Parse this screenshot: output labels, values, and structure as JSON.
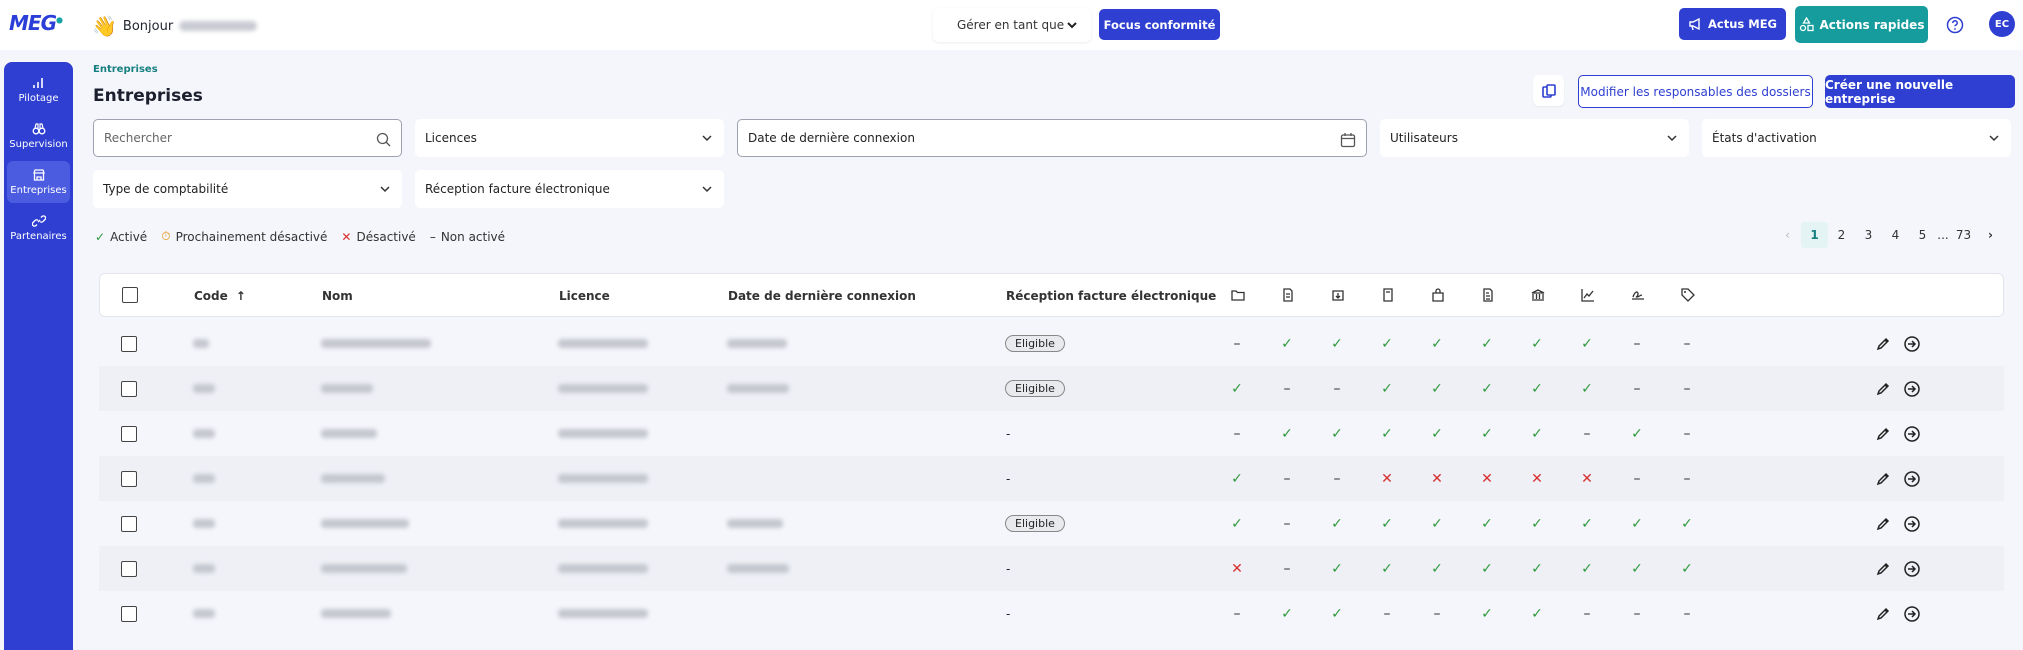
{
  "app": {
    "logo": "MEG",
    "greeting": "Bonjour",
    "user_initials": "EC"
  },
  "topbar": {
    "manage_as": "Gérer en tant que",
    "focus": "Focus conformité",
    "actus": "Actus MEG",
    "actions_rapides": "Actions rapides"
  },
  "sidebar": {
    "items": [
      {
        "label": "Pilotage",
        "icon": "bar-chart-icon"
      },
      {
        "label": "Supervision",
        "icon": "binoculars-icon"
      },
      {
        "label": "Entreprises",
        "icon": "store-icon",
        "active": true
      },
      {
        "label": "Partenaires",
        "icon": "link-icon"
      }
    ]
  },
  "page": {
    "breadcrumb": "Entreprises",
    "title": "Entreprises",
    "modify_btn": "Modifier les responsables des dossiers",
    "create_btn": "Créer une nouvelle entreprise"
  },
  "filters": {
    "search_placeholder": "Rechercher",
    "licences": "Licences",
    "date": "Date de dernière connexion",
    "users": "Utilisateurs",
    "activation": "États d'activation",
    "compta": "Type de comptabilité",
    "reception": "Réception facture électronique"
  },
  "legend": {
    "active": "Activé",
    "soon": "Prochainement désactivé",
    "disabled": "Désactivé",
    "inactive": "Non activé"
  },
  "pagination": {
    "pages": [
      "1",
      "2",
      "3",
      "4",
      "5"
    ],
    "ellipsis": "...",
    "last": "73",
    "current": "1"
  },
  "table": {
    "headers": {
      "code": "Code",
      "nom": "Nom",
      "licence": "Licence",
      "date": "Date de dernière connexion",
      "reception": "Réception facture électronique"
    },
    "module_icons": [
      "folder-icon",
      "document-icon",
      "import-icon",
      "calculator-icon",
      "bag-icon",
      "invoice-icon",
      "bank-icon",
      "chart-line-icon",
      "signature-icon",
      "tag-icon"
    ],
    "rows": [
      {
        "date": true,
        "reception": "Eligible",
        "modules": [
          "-",
          "v",
          "v",
          "v",
          "v",
          "v",
          "v",
          "v",
          "-",
          "-"
        ]
      },
      {
        "date": true,
        "reception": "Eligible",
        "modules": [
          "v",
          "-",
          "-",
          "v",
          "v",
          "v",
          "v",
          "v",
          "-",
          "-"
        ]
      },
      {
        "date": false,
        "reception": "-",
        "modules": [
          "-",
          "v",
          "v",
          "v",
          "v",
          "v",
          "v",
          "-",
          "v",
          "-"
        ]
      },
      {
        "date": false,
        "reception": "-",
        "modules": [
          "v",
          "-",
          "-",
          "x",
          "x",
          "x",
          "x",
          "x",
          "-",
          "-"
        ]
      },
      {
        "date": true,
        "reception": "Eligible",
        "modules": [
          "v",
          "-",
          "v",
          "v",
          "v",
          "v",
          "v",
          "v",
          "v",
          "v"
        ]
      },
      {
        "date": true,
        "reception": "-",
        "modules": [
          "x",
          "-",
          "v",
          "v",
          "v",
          "v",
          "v",
          "v",
          "v",
          "v"
        ]
      },
      {
        "date": false,
        "reception": "-",
        "modules": [
          "-",
          "v",
          "v",
          "-",
          "-",
          "v",
          "v",
          "-",
          "-",
          "-"
        ]
      }
    ]
  },
  "colors": {
    "primary": "#2e3fd1",
    "teal": "#169c9c",
    "ok": "#2e9a3d",
    "ko": "#d82e2e"
  }
}
